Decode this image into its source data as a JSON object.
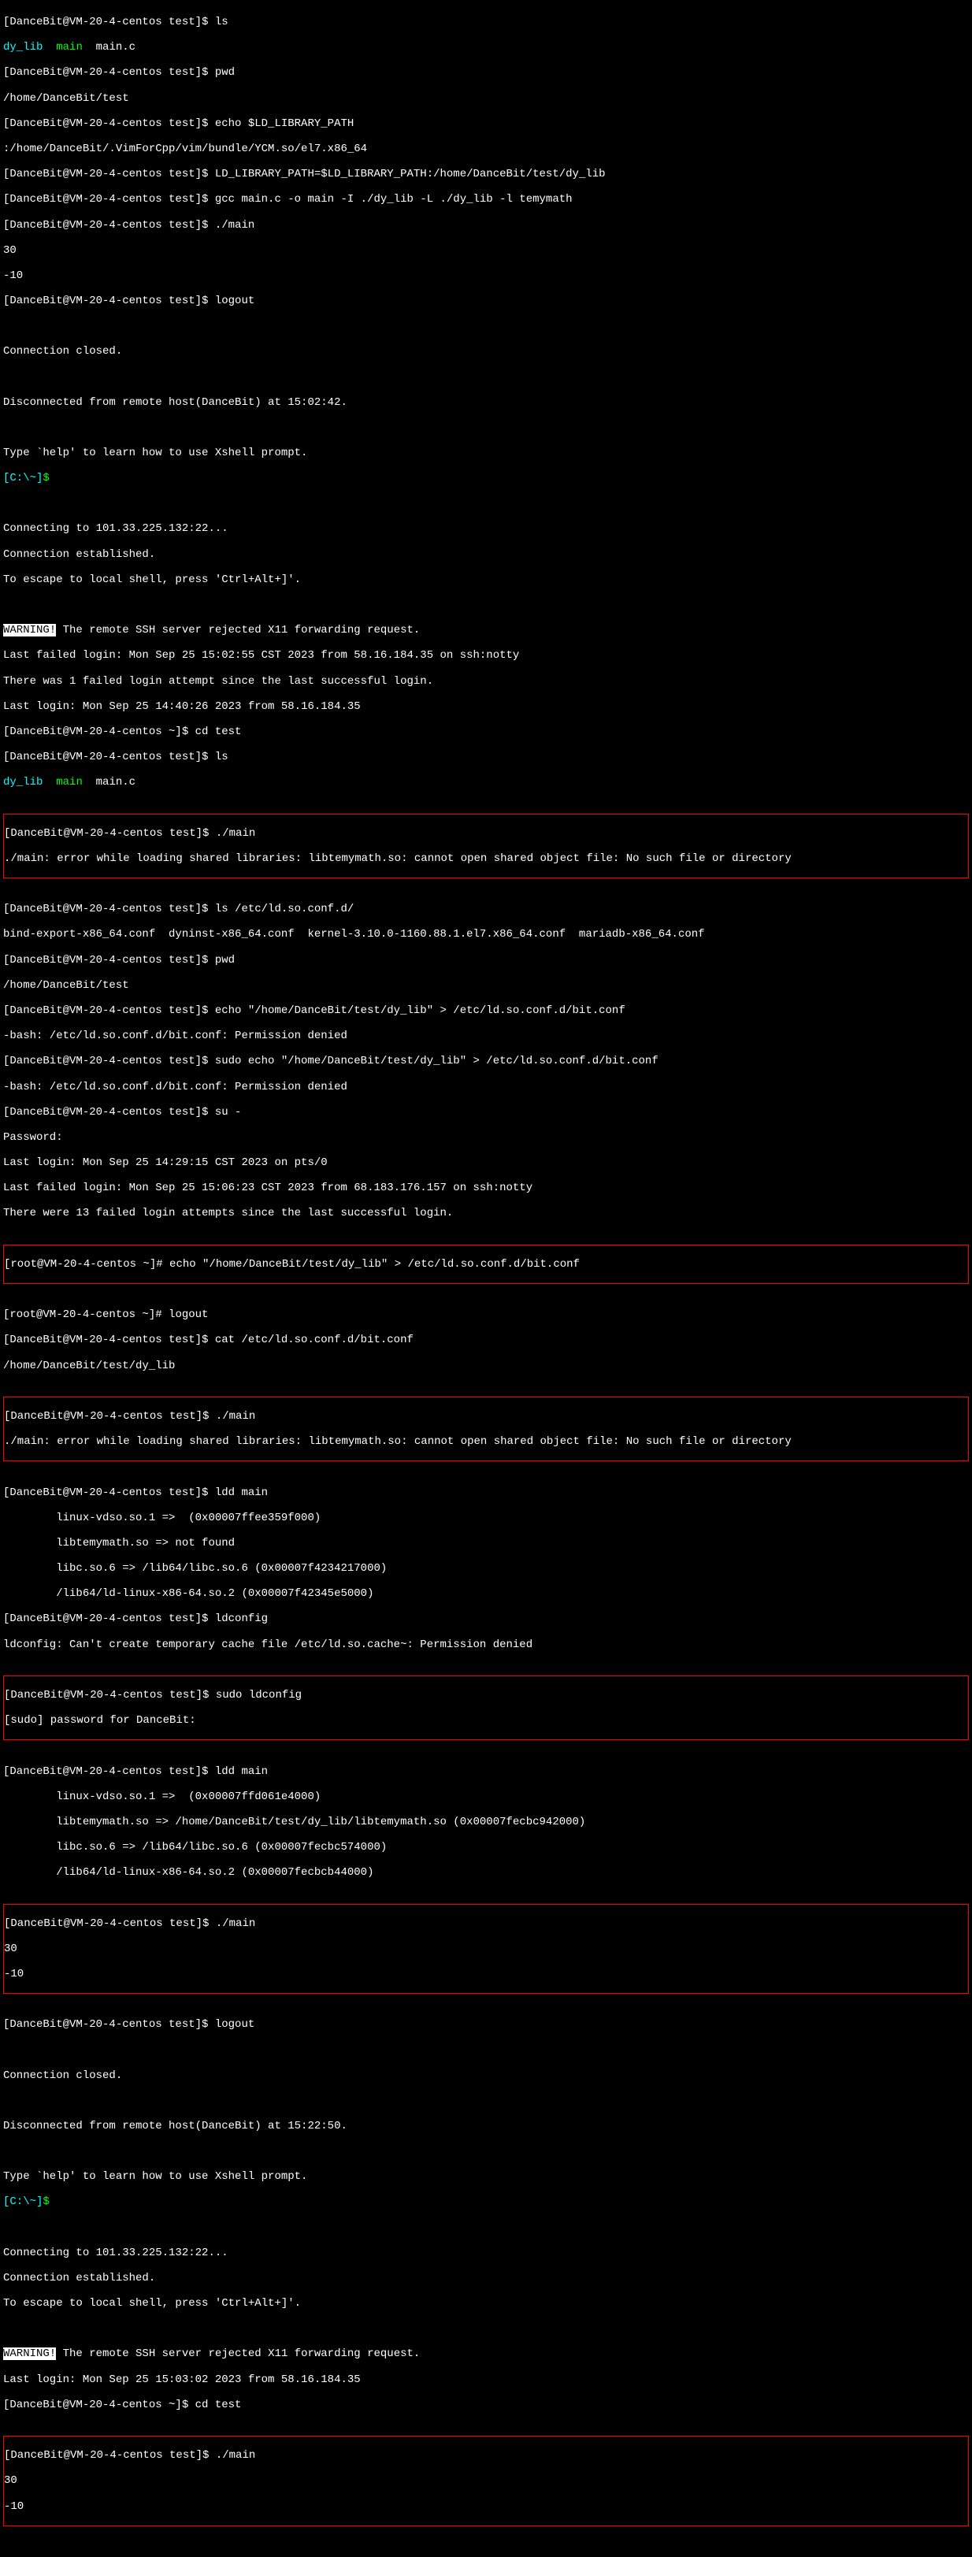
{
  "prompts": {
    "test": "[DanceBit@VM-20-4-centos test]$ ",
    "home": "[DanceBit@VM-20-4-centos ~]$ ",
    "root": "[root@VM-20-4-centos ~]# ",
    "local": "[C:\\~]",
    "local_dollar": "$"
  },
  "ls_out": {
    "dy_lib": "dy_lib",
    "main": "main",
    "main_c": "  main.c"
  },
  "lines": {
    "l01_cmd": "ls",
    "l03_cmd": "pwd",
    "l04_out": "/home/DanceBit/test",
    "l05_cmd": "echo $LD_LIBRARY_PATH",
    "l06_out": ":/home/DanceBit/.VimForCpp/vim/bundle/YCM.so/el7.x86_64",
    "l07_cmd": "LD_LIBRARY_PATH=$LD_LIBRARY_PATH:/home/DanceBit/test/dy_lib",
    "l08_cmd": "gcc main.c -o main -I ./dy_lib -L ./dy_lib -l temymath",
    "l09_cmd": "./main",
    "l10_out": "30",
    "l11_out": "-10",
    "l12_cmd": "logout",
    "l13_blank": "",
    "l14_out": "Connection closed.",
    "l15_blank": "",
    "l16_out": "Disconnected from remote host(DanceBit) at 15:02:42.",
    "l17_blank": "",
    "l18_out": "Type `help' to learn how to use Xshell prompt.",
    "l20_blank": "",
    "l21_out": "Connecting to 101.33.225.132:22...",
    "l22_out": "Connection established.",
    "l23_out": "To escape to local shell, press 'Ctrl+Alt+]'.",
    "l24_blank": "",
    "l25_warn": "WARNING!",
    "l25_rest": " The remote SSH server rejected X11 forwarding request.",
    "l26_out": "Last failed login: Mon Sep 25 15:02:55 CST 2023 from 58.16.184.35 on ssh:notty",
    "l27_out": "There was 1 failed login attempt since the last successful login.",
    "l28_out": "Last login: Mon Sep 25 14:40:26 2023 from 58.16.184.35",
    "l29_cmd": "cd test",
    "l30_cmd": "ls",
    "l32_cmd": "./main",
    "l33_out": "./main: error while loading shared libraries: libtemymath.so: cannot open shared object file: No such file or directory",
    "l34_cmd": "ls /etc/ld.so.conf.d/",
    "l35_out": "bind-export-x86_64.conf  dyninst-x86_64.conf  kernel-3.10.0-1160.88.1.el7.x86_64.conf  mariadb-x86_64.conf",
    "l36_cmd": "pwd",
    "l37_out": "/home/DanceBit/test",
    "l38_cmd": "echo \"/home/DanceBit/test/dy_lib\" > /etc/ld.so.conf.d/bit.conf",
    "l39_out": "-bash: /etc/ld.so.conf.d/bit.conf: Permission denied",
    "l40_cmd": "sudo echo \"/home/DanceBit/test/dy_lib\" > /etc/ld.so.conf.d/bit.conf",
    "l41_out": "-bash: /etc/ld.so.conf.d/bit.conf: Permission denied",
    "l42_cmd": "su -",
    "l43_out": "Password:",
    "l44_out": "Last login: Mon Sep 25 14:29:15 CST 2023 on pts/0",
    "l45_out": "Last failed login: Mon Sep 25 15:06:23 CST 2023 from 68.183.176.157 on ssh:notty",
    "l46_out": "There were 13 failed login attempts since the last successful login.",
    "l47_cmd": "echo \"/home/DanceBit/test/dy_lib\" > /etc/ld.so.conf.d/bit.conf",
    "l48_cmd": "logout",
    "l49_cmd": "cat /etc/ld.so.conf.d/bit.conf",
    "l50_out": "/home/DanceBit/test/dy_lib",
    "l51_cmd": "./main",
    "l52_out": "./main: error while loading shared libraries: libtemymath.so: cannot open shared object file: No such file or directory",
    "l53_cmd": "ldd main",
    "l54_out": "        linux-vdso.so.1 =>  (0x00007ffee359f000)",
    "l55_out": "        libtemymath.so => not found",
    "l56_out": "        libc.so.6 => /lib64/libc.so.6 (0x00007f4234217000)",
    "l57_out": "        /lib64/ld-linux-x86-64.so.2 (0x00007f42345e5000)",
    "l58_cmd": "ldconfig",
    "l59_out": "ldconfig: Can't create temporary cache file /etc/ld.so.cache~: Permission denied",
    "l60_cmd": "sudo ldconfig",
    "l61_out": "[sudo] password for DanceBit:",
    "l62_cmd": "ldd main",
    "l63_out": "        linux-vdso.so.1 =>  (0x00007ffd061e4000)",
    "l64_out": "        libtemymath.so => /home/DanceBit/test/dy_lib/libtemymath.so (0x00007fecbc942000)",
    "l65_out": "        libc.so.6 => /lib64/libc.so.6 (0x00007fecbc574000)",
    "l66_out": "        /lib64/ld-linux-x86-64.so.2 (0x00007fecbcb44000)",
    "l67_cmd": "./main",
    "l68_out": "30",
    "l69_out": "-10",
    "l70_cmd": "logout",
    "l71_blank": "",
    "l72_out": "Connection closed.",
    "l73_blank": "",
    "l74_out": "Disconnected from remote host(DanceBit) at 15:22:50.",
    "l75_blank": "",
    "l76_out": "Type `help' to learn how to use Xshell prompt.",
    "l78_blank": "",
    "l79_out": "Connecting to 101.33.225.132:22...",
    "l80_out": "Connection established.",
    "l81_out": "To escape to local shell, press 'Ctrl+Alt+]'.",
    "l82_blank": "",
    "l83_warn": "WARNING!",
    "l83_rest": " The remote SSH server rejected X11 forwarding request.",
    "l84_out": "Last login: Mon Sep 25 15:03:02 2023 from 58.16.184.35",
    "l85_cmd": "cd test",
    "l86_cmd": "./main",
    "l87_out": "30",
    "l88_out": "-10"
  }
}
